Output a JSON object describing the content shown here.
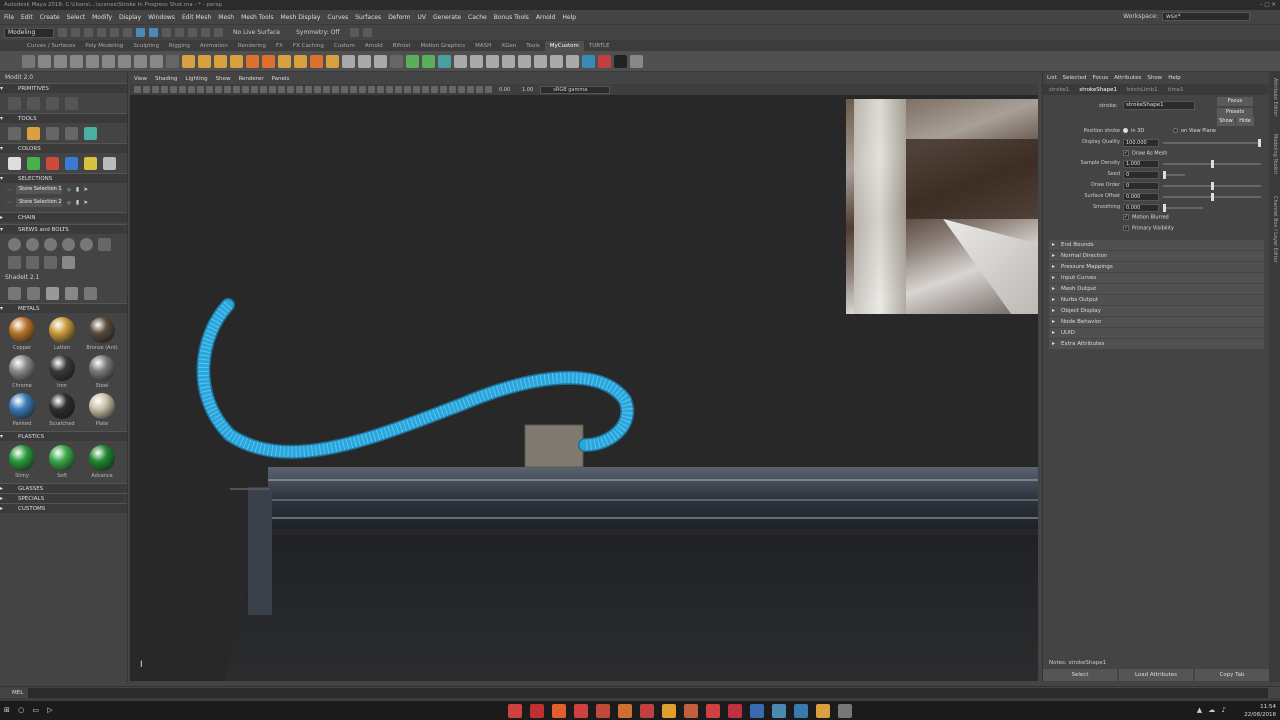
{
  "title_bar": {
    "text": "Autodesk Maya 2018: C:\\Users\\...\\scenes\\Stroke In Progress Shot.ma - * - persp",
    "controls": "– □ ✕"
  },
  "menu_bar": {
    "items": [
      "File",
      "Edit",
      "Create",
      "Select",
      "Modify",
      "Display",
      "Windows",
      "Edit Mesh",
      "Mesh",
      "Mesh Tools",
      "Mesh Display",
      "Curves",
      "Surfaces",
      "Deform",
      "UV",
      "Generate",
      "Cache",
      "Bonus Tools",
      "Arnold",
      "Help"
    ],
    "workspace_label": "Workspace:",
    "workspace_value": "wsx*"
  },
  "status_line": {
    "mode": "Modeling",
    "live_surface": "No Live Surface",
    "symmetry": "Symmetry: Off"
  },
  "shelf_tabs": {
    "items": [
      "Curves / Surfaces",
      "Poly Modeling",
      "Sculpting",
      "Rigging",
      "Animation",
      "Rendering",
      "FX",
      "FX Caching",
      "Custom",
      "Arnold",
      "Bifrost",
      "Motion Graphics",
      "MASH",
      "XGen",
      "Tools",
      "MyCustom",
      "TURTLE"
    ],
    "active": "MyCustom"
  },
  "left_panel": {
    "title": "Modit 2.0",
    "sections": {
      "primitives": "PRIMITIVES",
      "tools": "TOOLS",
      "colors": "COLORS",
      "selections": "SELECTIONS",
      "chain": "CHAIN",
      "screws": "SREWS and BOLTS",
      "shadeit": "ShadeIt 2.1",
      "metals": "METALS",
      "plastics": "PLASTICS",
      "glasses": "GLASSES",
      "specials": "SPECIALS",
      "customs": "CUSTOMS"
    },
    "store_selection_1": "Store Selection 1",
    "store_selection_2": "Store Selection 2",
    "metals": [
      {
        "label": "Copper",
        "color": "#b8742a"
      },
      {
        "label": "Latton",
        "color": "#c99a3a"
      },
      {
        "label": "Bronze (Ant)",
        "color": "#5a4a3a"
      },
      {
        "label": "Chrome",
        "color": "#8a8a8a"
      },
      {
        "label": "Iron",
        "color": "#3a3a3a"
      },
      {
        "label": "Steel",
        "color": "#7a7a7a"
      },
      {
        "label": "Painted",
        "color": "#3a7ab8"
      },
      {
        "label": "Scratched",
        "color": "#2e2e2e"
      },
      {
        "label": "Plate",
        "color": "#c8c0a8"
      }
    ],
    "plastics": [
      {
        "label": "Shiny",
        "color": "#2a9a3a"
      },
      {
        "label": "Soft",
        "color": "#3aa84a"
      },
      {
        "label": "Advance",
        "color": "#1e8a30"
      }
    ]
  },
  "viewport": {
    "menu": [
      "View",
      "Shading",
      "Lighting",
      "Show",
      "Renderer",
      "Panels"
    ],
    "field_a": "0.00",
    "field_b": "1.00",
    "color_space": "sRGB gamma",
    "curve_color": "#2aa6dc"
  },
  "attribute_editor": {
    "menu": [
      "List",
      "Selected",
      "Focus",
      "Attributes",
      "Show",
      "Help"
    ],
    "tabs": [
      "stroke1",
      "strokeShape1",
      "birchLimb1",
      "time1"
    ],
    "active_tab": "strokeShape1",
    "node_label": "stroke:",
    "node_value": "strokeShape1",
    "focus_btn": "Focus",
    "presets_btn": "Presets",
    "show_btn": "Show",
    "hide_btn": "Hide",
    "position_stroke_label": "Position stroke",
    "position_in_3d": "in 3D",
    "position_on_view": "on View Plane",
    "display_quality_label": "Display Quality",
    "display_quality_value": "100.000",
    "draw_as_mesh": "Draw As Mesh",
    "sample_density_label": "Sample Density",
    "sample_density_value": "1.000",
    "seed_label": "Seed",
    "seed_value": "0",
    "draw_order_label": "Draw Order",
    "draw_order_value": "0",
    "surface_offset_label": "Surface Offset",
    "surface_offset_value": "0.000",
    "smoothing_label": "Smoothing",
    "smoothing_value": "0.000",
    "motion_blurred": "Motion Blurred",
    "primary_visibility": "Primary Visibility",
    "collapsed_sections": [
      "End Bounds",
      "Normal Direction",
      "Pressure Mappings",
      "Input Curves",
      "Mesh Output",
      "Nurbs Output",
      "Object Display",
      "Node Behavior",
      "UUID",
      "Extra Attributes"
    ],
    "notes": "Notes: strokeShape1",
    "select_btn": "Select",
    "load_attributes_btn": "Load Attributes",
    "copy_tab_btn": "Copy Tab"
  },
  "side_tabs": [
    "Attribute Editor",
    "Modeling Toolkit",
    "Channel Box / Layer Editor"
  ],
  "command_line": {
    "mel_label": "MEL"
  },
  "taskbar": {
    "time": "11:54",
    "date": "22/08/2018"
  }
}
